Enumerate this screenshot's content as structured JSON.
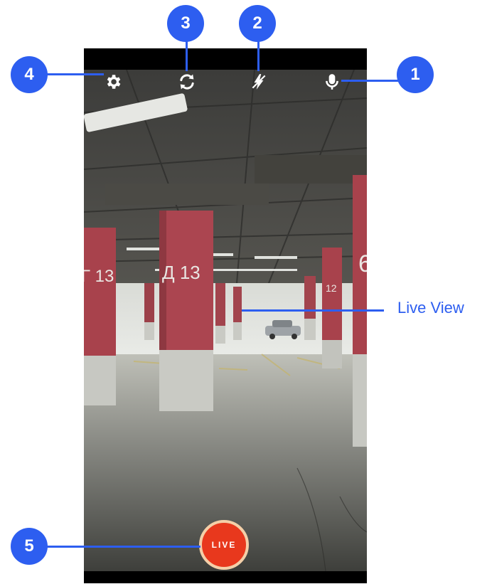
{
  "live_button": {
    "label": "LIVE"
  },
  "toolbar": {
    "settings_icon": "gear-icon",
    "switch_camera_icon": "camera-switch-icon",
    "flash_icon": "flash-off-icon",
    "microphone_icon": "microphone-icon"
  },
  "annotations": {
    "badges": [
      "1",
      "2",
      "3",
      "4",
      "5"
    ],
    "live_view_label": "Live View"
  },
  "scene": {
    "pillar_labels": [
      "Г 13",
      "Д 13",
      "12",
      "6"
    ]
  },
  "colors": {
    "callout": "#2d5ef0",
    "live_button": "#e8381d",
    "live_button_ring": "#f4cfa8",
    "pillar_red": "#a8424c"
  }
}
